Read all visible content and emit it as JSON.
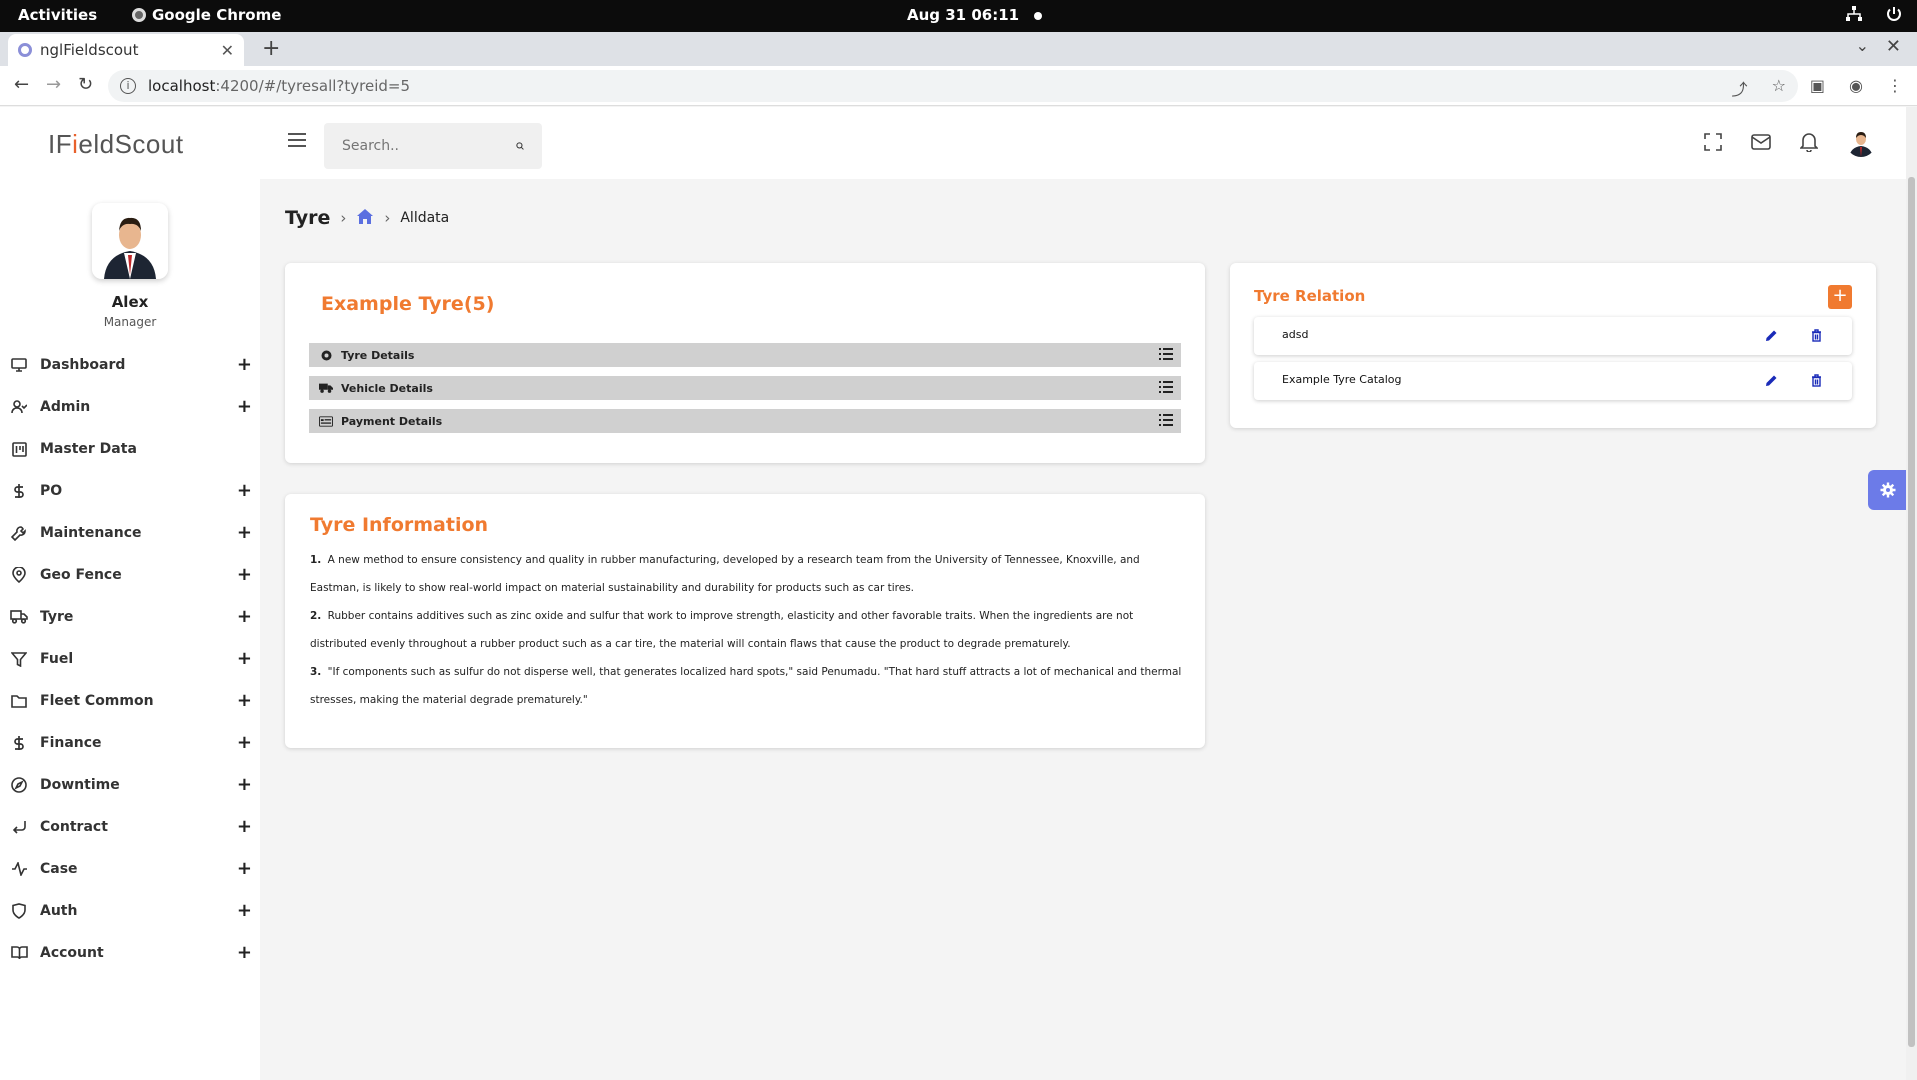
{
  "system": {
    "activities": "Activities",
    "app_name": "Google Chrome",
    "clock": "Aug 31  06:11"
  },
  "browser": {
    "tab_title": "nglFieldscout",
    "url_host": "localhost",
    "url_path": ":4200/#/tyresall?tyreid=5"
  },
  "sidebar": {
    "logo_prefix": "IF",
    "logo_accent": "i",
    "logo_suffix": "eldScout",
    "user_name": "Alex",
    "user_role": "Manager",
    "items": [
      {
        "label": "Dashboard",
        "icon": "monitor-icon",
        "expandable": true
      },
      {
        "label": "Admin",
        "icon": "user-icon",
        "expandable": true
      },
      {
        "label": "Master Data",
        "icon": "board-icon",
        "expandable": false
      },
      {
        "label": "PO",
        "icon": "dollar-icon",
        "expandable": true
      },
      {
        "label": "Maintenance",
        "icon": "wrench-icon",
        "expandable": true
      },
      {
        "label": "Geo Fence",
        "icon": "map-pin-icon",
        "expandable": true
      },
      {
        "label": "Tyre",
        "icon": "truck-icon",
        "expandable": true
      },
      {
        "label": "Fuel",
        "icon": "filter-icon",
        "expandable": true
      },
      {
        "label": "Fleet Common",
        "icon": "folder-icon",
        "expandable": true
      },
      {
        "label": "Finance",
        "icon": "dollar-icon",
        "expandable": true
      },
      {
        "label": "Downtime",
        "icon": "compass-icon",
        "expandable": true
      },
      {
        "label": "Contract",
        "icon": "corner-down-left-icon",
        "expandable": true
      },
      {
        "label": "Case",
        "icon": "activity-icon",
        "expandable": true
      },
      {
        "label": "Auth",
        "icon": "shield-icon",
        "expandable": true
      },
      {
        "label": "Account",
        "icon": "book-icon",
        "expandable": true
      }
    ]
  },
  "header": {
    "search_placeholder": "Search.."
  },
  "breadcrumb": {
    "title": "Tyre",
    "current": "Alldata"
  },
  "tyre_card": {
    "title": "Example Tyre(5)",
    "sections": [
      "Tyre Details",
      "Vehicle Details",
      "Payment Details"
    ]
  },
  "relation_card": {
    "title": "Tyre Relation",
    "items": [
      "adsd",
      "Example Tyre Catalog"
    ]
  },
  "info_card": {
    "title": "Tyre Information",
    "paragraphs": [
      {
        "num": "1.",
        "text": "A new method to ensure consistency and quality in rubber manufacturing, developed by a research team from the University of Tennessee, Knoxville, and Eastman, is likely to show real-world impact on material sustainability and durability for products such as car tires."
      },
      {
        "num": "2.",
        "text": "Rubber contains additives such as zinc oxide and sulfur that work to improve strength, elasticity and other favorable traits. When the ingredients are not distributed evenly throughout a rubber product such as a car tire, the material will contain flaws that cause the product to degrade prematurely."
      },
      {
        "num": "3.",
        "text": "\"If components such as sulfur do not disperse well, that generates localized hard spots,\" said Penumadu. \"That hard stuff attracts a lot of mechanical and thermal stresses, making the material degrade prematurely.\""
      }
    ]
  },
  "colors": {
    "accent": "#f07a30",
    "brand_blue": "#6c7be8",
    "action_blue": "#1a2bb8"
  }
}
